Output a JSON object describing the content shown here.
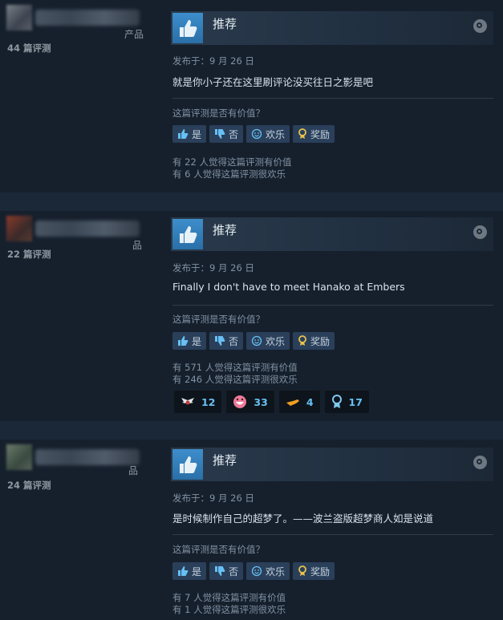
{
  "reviews": [
    {
      "product_tail": "产品",
      "review_count": "44 篇评测",
      "verdict": "推荐",
      "posted": "发布于：9 月 26 日",
      "content": "就是你小子还在这里刷评论没买往日之影是吧",
      "helpful_question": "这篇评测是否有价值？",
      "buttons": {
        "yes": "是",
        "no": "否",
        "funny": "欢乐",
        "award": "奖励"
      },
      "stat_helpful": "有 22 人觉得这篇评测有价值",
      "stat_funny": "有 6 人觉得这篇评测很欢乐"
    },
    {
      "product_tail": "品",
      "review_count": "22 篇评测",
      "verdict": "推荐",
      "posted": "发布于：9 月 26 日",
      "content": "Finally I don't have to meet Hanako at Embers",
      "helpful_question": "这篇评测是否有价值？",
      "buttons": {
        "yes": "是",
        "no": "否",
        "funny": "欢乐",
        "award": "奖励"
      },
      "stat_helpful": "有 571 人觉得这篇评测有价值",
      "stat_funny": "有 246 人觉得这篇评测很欢乐",
      "awards": [
        {
          "icon": "wings-award-icon",
          "count": "12"
        },
        {
          "icon": "grin-award-icon",
          "count": "33"
        },
        {
          "icon": "golden-hand-award-icon",
          "count": "4"
        },
        {
          "icon": "medal-award-icon",
          "count": "17"
        }
      ]
    },
    {
      "product_tail": "品",
      "review_count": "24 篇评测",
      "verdict": "推荐",
      "posted": "发布于：9 月 26 日",
      "content": "是时候制作自己的超梦了。——波兰盗版超梦商人如是说道",
      "helpful_question": "这篇评测是否有价值？",
      "buttons": {
        "yes": "是",
        "no": "否",
        "funny": "欢乐",
        "award": "奖励"
      },
      "stat_helpful": "有 7 人觉得这篇评测有价值",
      "stat_funny": "有 1 人觉得这篇评测很欢乐"
    }
  ],
  "colors": {
    "background": "#1b2838",
    "card": "#16202d",
    "accent": "#66c0f4",
    "button": "#2a3f5a"
  }
}
